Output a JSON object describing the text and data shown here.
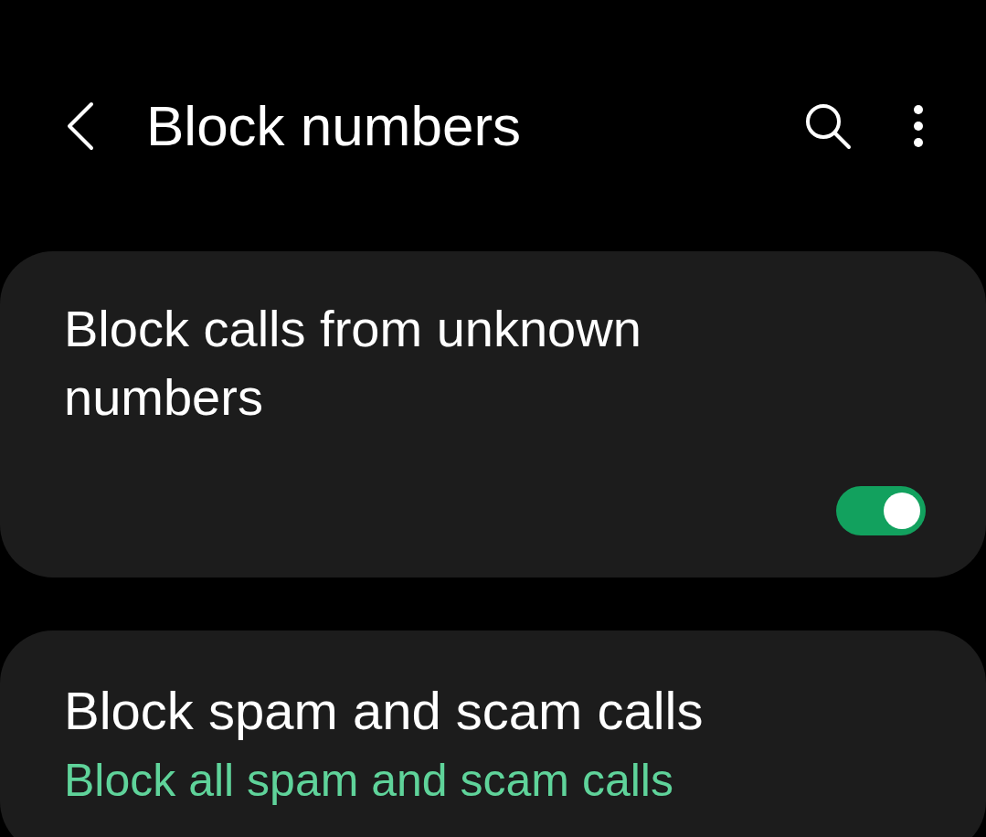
{
  "header": {
    "title": "Block numbers"
  },
  "settings": [
    {
      "kind": "toggle",
      "title": "Block calls from unknown numbers",
      "on": true
    },
    {
      "kind": "summary",
      "title": "Block spam and scam calls",
      "summary": "Block all spam and scam calls"
    }
  ]
}
